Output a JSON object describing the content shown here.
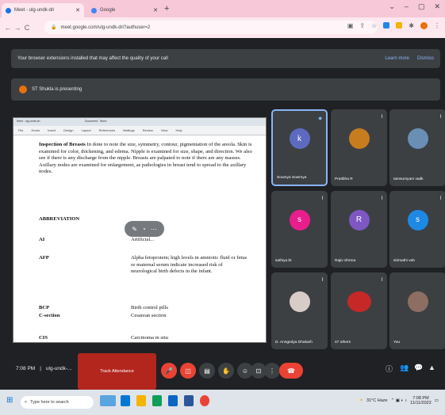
{
  "browser": {
    "tabs": [
      {
        "label": "Meet - ulg-undk-dri",
        "color": "#1a73e8"
      },
      {
        "label": "Google",
        "color": "#4285f4"
      }
    ],
    "new_tab": "+",
    "window_controls": [
      "⌄",
      "–",
      "▢",
      "✕"
    ],
    "url": "meet.google.com/ulg-undk-dri?authuser=2",
    "nav": [
      "←",
      "→",
      "C"
    ]
  },
  "banner": {
    "text": "Your browser extensions installed that may affect the quality of your call",
    "learn_more": "Learn more",
    "dismiss": "Dismiss"
  },
  "presenting": {
    "text": "ST Shukla is presenting"
  },
  "shared_doc": {
    "tabs": [
      "Meet - ulg-undk-dri",
      "Document - Word"
    ],
    "menu": [
      "File",
      "Home",
      "Insert",
      "Design",
      "Layout",
      "References",
      "Mailings",
      "Review",
      "View",
      "Help"
    ],
    "heading_insp": "Inspection of Breasts",
    "para1": "In done to note the size, symmetry, contour, pigmentation of the areola. Skin is examined for color, thickening, and edema. Nipple is examined for size, shape, and direction. We also see if there is any discharge from the nipple. Breasts are palpated to note if there are any masses. Axillary nodes are examined for enlargement, as pathologies in breast tend to spread to the axillary nodes.",
    "abbr_heading": "ABBREVIATION",
    "rows": [
      {
        "abbr": "AI",
        "desc": "Artificial..."
      },
      {
        "abbr": "AFP",
        "desc": "Alpha fetoprotein; high levels in amniotic fluid or fetus or maternal serum indicate increased risk of neurological birth defects in the infant."
      },
      {
        "abbr": "BCP",
        "desc": "Birth control pills"
      },
      {
        "abbr": "C-section",
        "desc": "Cesarean section"
      },
      {
        "abbr": "CIS",
        "desc": "Carcinoma in situ"
      }
    ]
  },
  "participants": [
    {
      "name": "Soumya Sowmya",
      "initial": "k",
      "color": "#5c6bc0",
      "mic": "◆"
    },
    {
      "name": "Pratibha R",
      "initial": "",
      "color": "#c77d1e",
      "mic": "⌇"
    },
    {
      "name": "tamsumyam vadk",
      "initial": "",
      "color": "#6a8fb5",
      "mic": "⌇"
    },
    {
      "name": "sathiya bt",
      "initial": "s",
      "color": "#e91e8c",
      "mic": "⌇"
    },
    {
      "name": "Rajiv Shrma",
      "initial": "R",
      "color": "#7e57c2",
      "mic": "⌇"
    },
    {
      "name": "sirimathi veb",
      "initial": "s",
      "color": "#1e88e5",
      "mic": "⌇"
    },
    {
      "name": "D. Anngedya Dhakarh",
      "initial": "",
      "color": "#d7ccc8",
      "mic": "⌇"
    },
    {
      "name": "47 others",
      "initial": "",
      "color": "#c62828",
      "mic": "⌇"
    },
    {
      "name": "You",
      "initial": "",
      "color": "#8d6e63",
      "mic": ""
    }
  ],
  "bottom": {
    "time": "7:08 PM",
    "meeting_code": "ulg-undk-...",
    "track_label": "Track Attendance",
    "controls": [
      {
        "name": "mic-off-button",
        "glyph": "🎤",
        "bg": "#ea4335"
      },
      {
        "name": "camera-off-button",
        "glyph": "◫",
        "bg": "#ea4335"
      },
      {
        "name": "captions-button",
        "glyph": "▤",
        "bg": "#3c4043"
      },
      {
        "name": "raise-hand-button",
        "glyph": "✋",
        "bg": "#3c4043"
      },
      {
        "name": "emoji-button",
        "glyph": "☺",
        "bg": "#3c4043"
      },
      {
        "name": "present-button",
        "glyph": "⊡",
        "bg": "#3c4043"
      },
      {
        "name": "more-options-button",
        "glyph": "⋮",
        "bg": "#3c4043"
      },
      {
        "name": "leave-call-button",
        "glyph": "☎",
        "bg": "#ea4335"
      }
    ],
    "right_icons": [
      "ⓘ",
      "👥",
      "💬",
      "▲"
    ]
  },
  "taskbar": {
    "search_placeholder": "Type here to search",
    "weather": "31°C Haze",
    "time": "7:08 PM",
    "date": "11/11/2022"
  }
}
